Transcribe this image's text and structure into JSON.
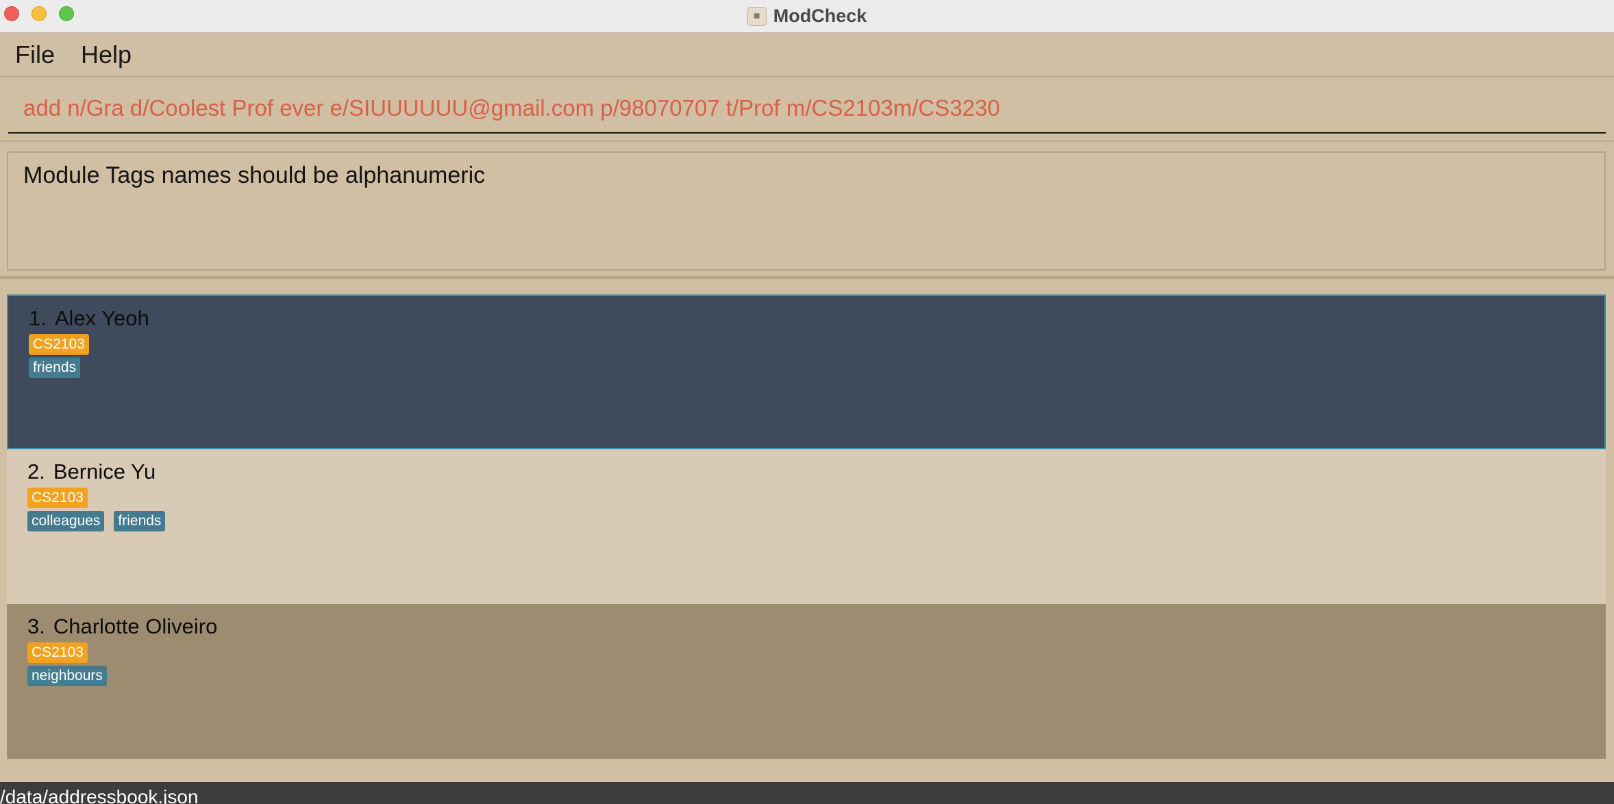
{
  "window": {
    "title": "ModCheck",
    "app_icon": "contact-book-icon"
  },
  "menu": {
    "items": [
      {
        "label": "File"
      },
      {
        "label": "Help"
      }
    ]
  },
  "command": {
    "value": "add n/Gra d/Coolest Prof ever e/SIUUUUUU@gmail.com p/98070707 t/Prof m/CS2103m/CS3230",
    "text_color": "#d9604a"
  },
  "result": {
    "message": "Module Tags names should be alphanumeric"
  },
  "persons": [
    {
      "index": "1.",
      "name": "Alex Yeoh",
      "modules": [
        "CS2103"
      ],
      "tags": [
        "friends"
      ],
      "selected": true
    },
    {
      "index": "2.",
      "name": "Bernice Yu",
      "modules": [
        "CS2103"
      ],
      "tags": [
        "colleagues",
        "friends"
      ],
      "selected": false
    },
    {
      "index": "3.",
      "name": "Charlotte Oliveiro",
      "modules": [
        "CS2103"
      ],
      "tags": [
        "neighbours"
      ],
      "selected": false
    }
  ],
  "status": {
    "path": "/data/addressbook.json"
  },
  "colors": {
    "background": "#d0bfa3",
    "selected_card": "#3f4b5d",
    "module_tag": "#f2a21f",
    "social_tag": "#447b8f"
  }
}
